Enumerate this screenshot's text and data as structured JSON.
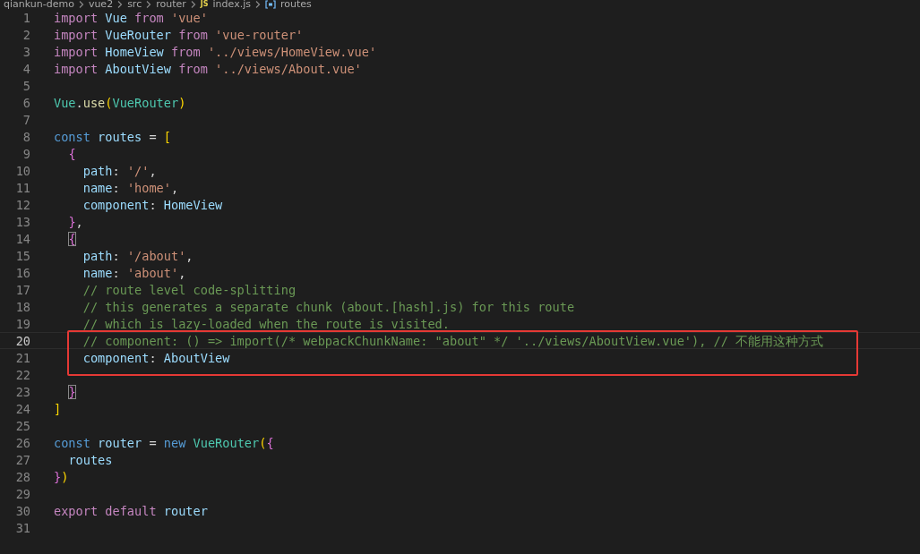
{
  "breadcrumb": [
    {
      "kind": "folder",
      "label": "qiankun-demo"
    },
    {
      "kind": "folder",
      "label": "vue2"
    },
    {
      "kind": "folder",
      "label": "src"
    },
    {
      "kind": "folder",
      "label": "router"
    },
    {
      "kind": "file",
      "icon_text": "JS",
      "label": "index.js"
    },
    {
      "kind": "symbol",
      "label": "routes"
    }
  ],
  "lines": [
    {
      "number": "1",
      "current": false,
      "boxed": false,
      "tokens": [
        {
          "kind": "kw",
          "text": "import"
        },
        {
          "kind": "var",
          "text": " Vue"
        },
        {
          "kind": "kw",
          "text": " from"
        },
        {
          "kind": "str",
          "text": " 'vue'"
        }
      ]
    },
    {
      "number": "2",
      "current": false,
      "boxed": false,
      "tokens": [
        {
          "kind": "kw",
          "text": "import"
        },
        {
          "kind": "var",
          "text": " VueRouter"
        },
        {
          "kind": "kw",
          "text": " from"
        },
        {
          "kind": "str",
          "text": " 'vue-router'"
        }
      ]
    },
    {
      "number": "3",
      "current": false,
      "boxed": false,
      "tokens": [
        {
          "kind": "kw",
          "text": "import"
        },
        {
          "kind": "var",
          "text": " HomeView"
        },
        {
          "kind": "kw",
          "text": " from"
        },
        {
          "kind": "str",
          "text": " '../views/HomeView.vue'"
        }
      ]
    },
    {
      "number": "4",
      "current": false,
      "boxed": false,
      "tokens": [
        {
          "kind": "kw",
          "text": "import"
        },
        {
          "kind": "var",
          "text": " AboutView"
        },
        {
          "kind": "kw",
          "text": " from"
        },
        {
          "kind": "str",
          "text": " '../views/About.vue'"
        }
      ]
    },
    {
      "number": "5",
      "current": false,
      "boxed": false
    },
    {
      "number": "6",
      "current": false,
      "boxed": false,
      "tokens": [
        {
          "kind": "type",
          "text": "Vue"
        },
        {
          "kind": "plain",
          "text": "."
        },
        {
          "kind": "fn",
          "text": "use"
        },
        {
          "kind": "b1",
          "text": "("
        },
        {
          "kind": "type",
          "text": "VueRouter"
        },
        {
          "kind": "b1",
          "text": ")"
        }
      ]
    },
    {
      "number": "7",
      "current": false,
      "boxed": false
    },
    {
      "number": "8",
      "current": false,
      "boxed": false,
      "tokens": [
        {
          "kind": "storage",
          "text": "const"
        },
        {
          "kind": "var",
          "text": " routes"
        },
        {
          "kind": "plain",
          "text": " ="
        },
        {
          "kind": "b1",
          "text": " ["
        }
      ]
    },
    {
      "number": "9",
      "current": false,
      "boxed": false,
      "tokens": [
        {
          "kind": "b2",
          "text": "  {"
        }
      ]
    },
    {
      "number": "10",
      "current": false,
      "boxed": false,
      "tokens": [
        {
          "kind": "var",
          "text": "    path"
        },
        {
          "kind": "plain",
          "text": ":"
        },
        {
          "kind": "str",
          "text": " '/'"
        },
        {
          "kind": "plain",
          "text": ","
        }
      ]
    },
    {
      "number": "11",
      "current": false,
      "boxed": false,
      "tokens": [
        {
          "kind": "var",
          "text": "    name"
        },
        {
          "kind": "plain",
          "text": ":"
        },
        {
          "kind": "str",
          "text": " 'home'"
        },
        {
          "kind": "plain",
          "text": ","
        }
      ]
    },
    {
      "number": "12",
      "current": false,
      "boxed": false,
      "tokens": [
        {
          "kind": "var",
          "text": "    component"
        },
        {
          "kind": "plain",
          "text": ":"
        },
        {
          "kind": "var",
          "text": " HomeView"
        }
      ]
    },
    {
      "number": "13",
      "current": false,
      "boxed": false,
      "tokens": [
        {
          "kind": "b2",
          "text": "  }"
        },
        {
          "kind": "plain",
          "text": ","
        }
      ]
    },
    {
      "number": "14",
      "current": false,
      "boxed": false,
      "tokens": [
        {
          "kind": "matchbrace",
          "text": "  {"
        }
      ]
    },
    {
      "number": "15",
      "current": false,
      "boxed": false,
      "tokens": [
        {
          "kind": "var",
          "text": "    path"
        },
        {
          "kind": "plain",
          "text": ":"
        },
        {
          "kind": "str",
          "text": " '/about'"
        },
        {
          "kind": "plain",
          "text": ","
        }
      ]
    },
    {
      "number": "16",
      "current": false,
      "boxed": false,
      "tokens": [
        {
          "kind": "var",
          "text": "    name"
        },
        {
          "kind": "plain",
          "text": ":"
        },
        {
          "kind": "str",
          "text": " 'about'"
        },
        {
          "kind": "plain",
          "text": ","
        }
      ]
    },
    {
      "number": "17",
      "current": false,
      "boxed": false,
      "tokens": [
        {
          "kind": "comment",
          "text": "    // route level code-splitting"
        }
      ]
    },
    {
      "number": "18",
      "current": false,
      "boxed": false,
      "tokens": [
        {
          "kind": "comment",
          "text": "    // this generates a separate chunk (about.[hash].js) for this route"
        }
      ]
    },
    {
      "number": "19",
      "current": false,
      "boxed": false,
      "tokens": [
        {
          "kind": "comment",
          "text": "    // which is lazy-loaded when the route is visited."
        }
      ]
    },
    {
      "number": "20",
      "current": true,
      "boxed": true,
      "tokens": [
        {
          "kind": "comment",
          "text": "    // component: () => import(/* webpackChunkName: \"about\" */ '../views/AboutView.vue'), // 不能用这种方式"
        }
      ]
    },
    {
      "number": "21",
      "current": false,
      "boxed": true,
      "tokens": [
        {
          "kind": "var",
          "text": "    component"
        },
        {
          "kind": "plain",
          "text": ":"
        },
        {
          "kind": "var",
          "text": " AboutView"
        }
      ]
    },
    {
      "number": "22",
      "current": false,
      "boxed": true
    },
    {
      "number": "23",
      "current": false,
      "boxed": false,
      "tokens": [
        {
          "kind": "matchbrace",
          "text": "  }"
        }
      ]
    },
    {
      "number": "24",
      "current": false,
      "boxed": false,
      "tokens": [
        {
          "kind": "b1",
          "text": "]"
        }
      ]
    },
    {
      "number": "25",
      "current": false,
      "boxed": false
    },
    {
      "number": "26",
      "current": false,
      "boxed": false,
      "tokens": [
        {
          "kind": "storage",
          "text": "const"
        },
        {
          "kind": "var",
          "text": " router"
        },
        {
          "kind": "plain",
          "text": " ="
        },
        {
          "kind": "storage",
          "text": " new"
        },
        {
          "kind": "type",
          "text": " VueRouter"
        },
        {
          "kind": "b1",
          "text": "("
        },
        {
          "kind": "b2",
          "text": "{"
        }
      ]
    },
    {
      "number": "27",
      "current": false,
      "boxed": false,
      "tokens": [
        {
          "kind": "var",
          "text": "  routes"
        }
      ]
    },
    {
      "number": "28",
      "current": false,
      "boxed": false,
      "tokens": [
        {
          "kind": "b2",
          "text": "}"
        },
        {
          "kind": "b1",
          "text": ")"
        }
      ]
    },
    {
      "number": "29",
      "current": false,
      "boxed": false
    },
    {
      "number": "30",
      "current": false,
      "boxed": false,
      "tokens": [
        {
          "kind": "kw",
          "text": "export"
        },
        {
          "kind": "kw",
          "text": " default"
        },
        {
          "kind": "var",
          "text": " router"
        }
      ]
    },
    {
      "number": "31",
      "current": false,
      "boxed": false
    }
  ]
}
